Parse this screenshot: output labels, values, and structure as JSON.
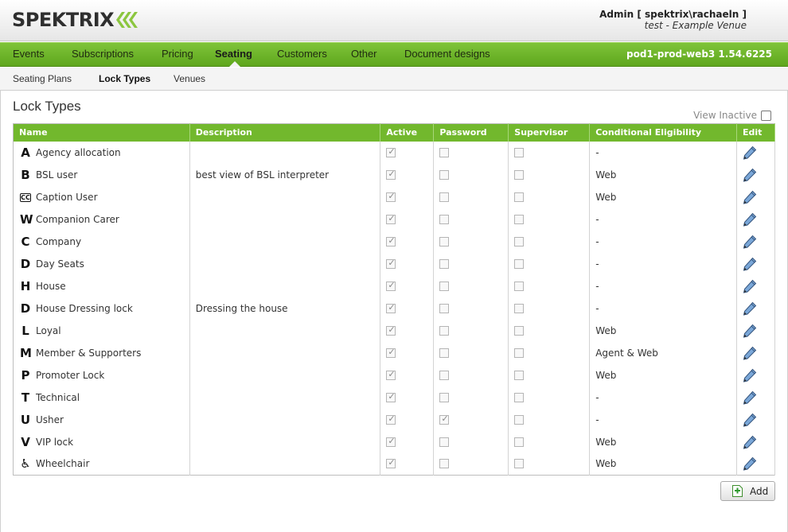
{
  "header": {
    "logo_text": "SPEKTRIX",
    "user_text": "Admin [ spektrix\\rachaeln ]",
    "venue_text": "test - Example Venue"
  },
  "nav": {
    "items": [
      "Events",
      "Subscriptions",
      "Pricing",
      "Seating",
      "Customers",
      "Other",
      "Document designs"
    ],
    "active": "Seating",
    "server_info": "pod1-prod-web3 1.54.6225"
  },
  "subnav": {
    "items": [
      "Seating Plans",
      "Lock Types",
      "Venues"
    ],
    "active": "Lock Types"
  },
  "page": {
    "title": "Lock Types",
    "view_inactive_label": "View Inactive",
    "view_inactive_checked": false,
    "add_label": "Add"
  },
  "table": {
    "columns": [
      "Name",
      "Description",
      "Active",
      "Password",
      "Supervisor",
      "Conditional Eligibility",
      "Edit"
    ],
    "rows": [
      {
        "symbol": "A",
        "name": "Agency allocation",
        "description": "",
        "active": true,
        "password": false,
        "supervisor": false,
        "eligibility": "-"
      },
      {
        "symbol": "B",
        "name": "BSL user",
        "description": "best view of BSL interpreter",
        "active": true,
        "password": false,
        "supervisor": false,
        "eligibility": "Web"
      },
      {
        "symbol": "CC",
        "name": "Caption User",
        "description": "",
        "active": true,
        "password": false,
        "supervisor": false,
        "eligibility": "Web"
      },
      {
        "symbol": "W",
        "name": "Companion Carer",
        "description": "",
        "active": true,
        "password": false,
        "supervisor": false,
        "eligibility": "-"
      },
      {
        "symbol": "C",
        "name": "Company",
        "description": "",
        "active": true,
        "password": false,
        "supervisor": false,
        "eligibility": "-"
      },
      {
        "symbol": "D",
        "name": "Day Seats",
        "description": "",
        "active": true,
        "password": false,
        "supervisor": false,
        "eligibility": "-"
      },
      {
        "symbol": "H",
        "name": "House",
        "description": "",
        "active": true,
        "password": false,
        "supervisor": false,
        "eligibility": "-"
      },
      {
        "symbol": "D",
        "name": "House Dressing lock",
        "description": "Dressing the house",
        "active": true,
        "password": false,
        "supervisor": false,
        "eligibility": "-"
      },
      {
        "symbol": "L",
        "name": "Loyal",
        "description": "",
        "active": true,
        "password": false,
        "supervisor": false,
        "eligibility": "Web"
      },
      {
        "symbol": "M",
        "name": "Member & Supporters",
        "description": "",
        "active": true,
        "password": false,
        "supervisor": false,
        "eligibility": "Agent & Web"
      },
      {
        "symbol": "P",
        "name": "Promoter Lock",
        "description": "",
        "active": true,
        "password": false,
        "supervisor": false,
        "eligibility": "Web"
      },
      {
        "symbol": "T",
        "name": "Technical",
        "description": "",
        "active": true,
        "password": false,
        "supervisor": false,
        "eligibility": "-"
      },
      {
        "symbol": "U",
        "name": "Usher",
        "description": "",
        "active": true,
        "password": true,
        "supervisor": false,
        "eligibility": "-"
      },
      {
        "symbol": "V",
        "name": "VIP lock",
        "description": "",
        "active": true,
        "password": false,
        "supervisor": false,
        "eligibility": "Web"
      },
      {
        "symbol": "♿",
        "name": "Wheelchair",
        "description": "",
        "active": true,
        "password": false,
        "supervisor": false,
        "eligibility": "Web"
      }
    ]
  },
  "colors": {
    "brand_green": "#72b82d",
    "logo_chevron": "#8cc63f"
  }
}
